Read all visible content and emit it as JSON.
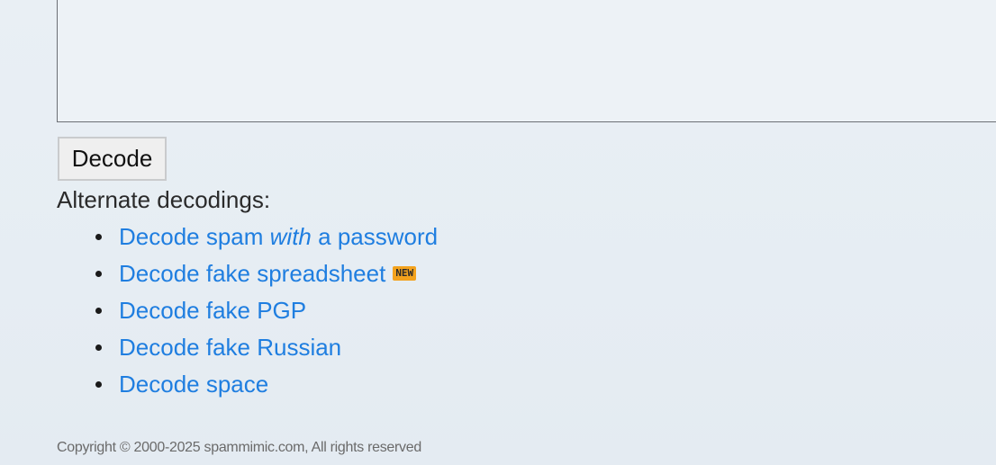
{
  "decode_form": {
    "decode_button_label": "Decode",
    "alternate_label": "Alternate decodings:"
  },
  "alternate_decodings": [
    {
      "prefix": "Decode spam ",
      "italic": "with",
      "suffix": " a password",
      "badge": ""
    },
    {
      "prefix": "Decode fake spreadsheet",
      "italic": "",
      "suffix": "",
      "badge": "NEW"
    },
    {
      "prefix": "Decode fake PGP",
      "italic": "",
      "suffix": "",
      "badge": ""
    },
    {
      "prefix": "Decode fake Russian",
      "italic": "",
      "suffix": "",
      "badge": ""
    },
    {
      "prefix": "Decode space",
      "italic": "",
      "suffix": "",
      "badge": ""
    }
  ],
  "footer": {
    "copyright": "Copyright © 2000-2025 spammimic.com, All rights reserved"
  },
  "colors": {
    "link": "#1f7ee0",
    "badge_bg": "#f3a21d",
    "page_bg": "#e7eef4"
  }
}
